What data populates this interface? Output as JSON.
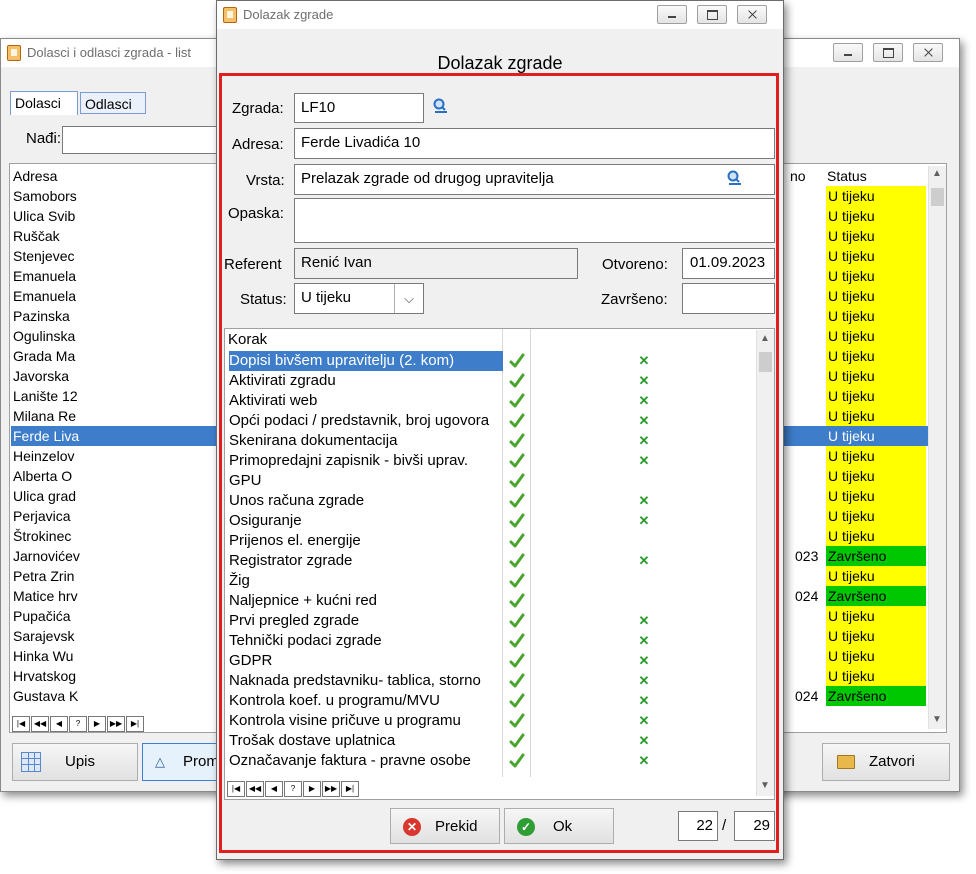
{
  "bg_window": {
    "title": "Dolasci i odlasci zgrada - list",
    "tabs": [
      "Dolasci",
      "Odlasci"
    ],
    "search_label": "Nađi:",
    "columns": {
      "address": "Adresa",
      "date_partial": "no",
      "status": "Status"
    },
    "rows": [
      {
        "addr": "Samobors",
        "date": "",
        "status": "U tijeku"
      },
      {
        "addr": "Ulica Svib",
        "date": "",
        "status": "U tijeku"
      },
      {
        "addr": "Ruščak",
        "date": "",
        "status": "U tijeku"
      },
      {
        "addr": "Stenjevec",
        "date": "",
        "status": "U tijeku"
      },
      {
        "addr": "Emanuela",
        "date": "",
        "status": "U tijeku"
      },
      {
        "addr": "Emanuela",
        "date": "",
        "status": "U tijeku"
      },
      {
        "addr": "Pazinska",
        "date": "",
        "status": "U tijeku"
      },
      {
        "addr": "Ogulinska",
        "date": "",
        "status": "U tijeku"
      },
      {
        "addr": "Grada Ma",
        "date": "",
        "status": "U tijeku"
      },
      {
        "addr": "Javorska",
        "date": "",
        "status": "U tijeku"
      },
      {
        "addr": "Lanište 12",
        "date": "",
        "status": "U tijeku"
      },
      {
        "addr": "Milana Re",
        "date": "",
        "status": "U tijeku"
      },
      {
        "addr": "Ferde Liva",
        "date": "",
        "status": "U tijeku"
      },
      {
        "addr": "Heinzelov",
        "date": "",
        "status": "U tijeku"
      },
      {
        "addr": "Alberta O",
        "date": "",
        "status": "U tijeku"
      },
      {
        "addr": "Ulica grad",
        "date": "",
        "status": "U tijeku"
      },
      {
        "addr": "Perjavica",
        "date": "",
        "status": "U tijeku"
      },
      {
        "addr": "Štrokinec",
        "date": "",
        "status": "U tijeku"
      },
      {
        "addr": "Jarnovićev",
        "date": "023",
        "status": "Završeno"
      },
      {
        "addr": "Petra Zrin",
        "date": "",
        "status": "U tijeku"
      },
      {
        "addr": "Matice hrv",
        "date": "024",
        "status": "Završeno"
      },
      {
        "addr": "Pupačića",
        "date": "",
        "status": "U tijeku"
      },
      {
        "addr": "Sarajevsk",
        "date": "",
        "status": "U tijeku"
      },
      {
        "addr": "Hinka Wu",
        "date": "",
        "status": "U tijeku"
      },
      {
        "addr": "Hrvatskog",
        "date": "",
        "status": "U tijeku"
      },
      {
        "addr": "Gustava K",
        "date": "024",
        "status": "Završeno"
      }
    ],
    "selected_row": 12,
    "buttons": {
      "upis": "Upis",
      "promijeni": "Prom",
      "zatvori": "Zatvori"
    },
    "nav": [
      "|◀",
      "◀◀",
      "◀",
      "?",
      "▶",
      "▶▶",
      "▶|"
    ]
  },
  "dialog": {
    "window_title": "Dolazak zgrade",
    "heading": "Dolazak zgrade",
    "labels": {
      "zgrada": "Zgrada:",
      "adresa": "Adresa:",
      "vrsta": "Vrsta:",
      "opaska": "Opaska:",
      "referent": "Referent",
      "otvoreno": "Otvoreno:",
      "status": "Status:",
      "zavrseno": "Završeno:"
    },
    "values": {
      "zgrada": "LF10",
      "adresa": "Ferde Livadića 10",
      "vrsta": "Prelazak zgrade od drugog upravitelja",
      "opaska": "",
      "referent": "Renić Ivan",
      "otvoreno": "01.09.2023",
      "status": "U tijeku",
      "zavrseno": ""
    },
    "grid_header": "Korak",
    "steps": [
      {
        "name": "Dopisi bivšem upravitelju (2. kom)",
        "x": true
      },
      {
        "name": "Aktivirati zgradu",
        "x": true
      },
      {
        "name": "Aktivirati web",
        "x": true
      },
      {
        "name": "Opći podaci / predstavnik, broj ugovora",
        "x": true
      },
      {
        "name": "Skenirana dokumentacija",
        "x": true
      },
      {
        "name": "Primopredajni zapisnik - bivši uprav.",
        "x": true
      },
      {
        "name": "GPU",
        "x": false
      },
      {
        "name": "Unos računa zgrade",
        "x": true
      },
      {
        "name": "Osiguranje",
        "x": true
      },
      {
        "name": "Prijenos el. energije",
        "x": false
      },
      {
        "name": "Registrator zgrade",
        "x": true
      },
      {
        "name": "Žig",
        "x": false
      },
      {
        "name": "Naljepnice + kućni red",
        "x": false
      },
      {
        "name": "Prvi pregled zgrade",
        "x": true
      },
      {
        "name": "Tehnički podaci zgrade",
        "x": true
      },
      {
        "name": "GDPR",
        "x": true
      },
      {
        "name": "Naknada predstavniku- tablica, storno",
        "x": true
      },
      {
        "name": "Kontrola koef. u programu/MVU",
        "x": true
      },
      {
        "name": "Kontrola visine pričuve u programu",
        "x": true
      },
      {
        "name": "Trošak dostave uplatnica",
        "x": true
      },
      {
        "name": "Označavanje faktura - pravne osobe",
        "x": true
      }
    ],
    "selected_step": 0,
    "buttons": {
      "prekid": "Prekid",
      "ok": "Ok"
    },
    "counter": {
      "current": "22",
      "separator": "/",
      "total": "29"
    }
  },
  "colors": {
    "in_progress": "#ffff00",
    "done": "#00c800",
    "selection": "#3d7dca",
    "highlight_border": "#e0201e",
    "check": "#4aa52e"
  }
}
